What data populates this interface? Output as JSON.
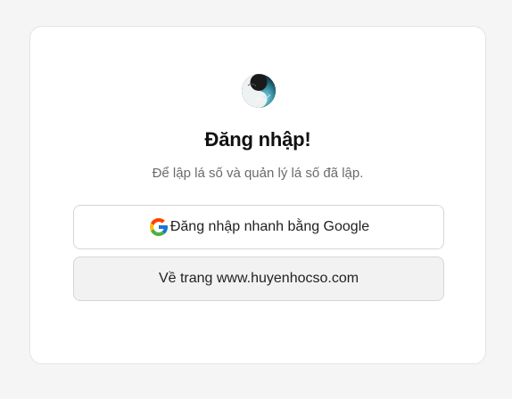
{
  "login": {
    "title": "Đăng nhập!",
    "subtitle": "Để lập lá số và quản lý lá số đã lập.",
    "google_button_label": "Đăng nhập nhanh bằng Google",
    "home_button_label": "Về trang www.huyenhocso.com"
  },
  "icons": {
    "logo": "yin-yang-logo",
    "google": "google-icon"
  },
  "colors": {
    "page_background": "#f5f5f5",
    "card_background": "#ffffff",
    "secondary_button_background": "#f2f2f2",
    "google_blue": "#4285F4",
    "google_red": "#EA4335",
    "google_yellow": "#FBBC05",
    "google_green": "#34A853"
  }
}
